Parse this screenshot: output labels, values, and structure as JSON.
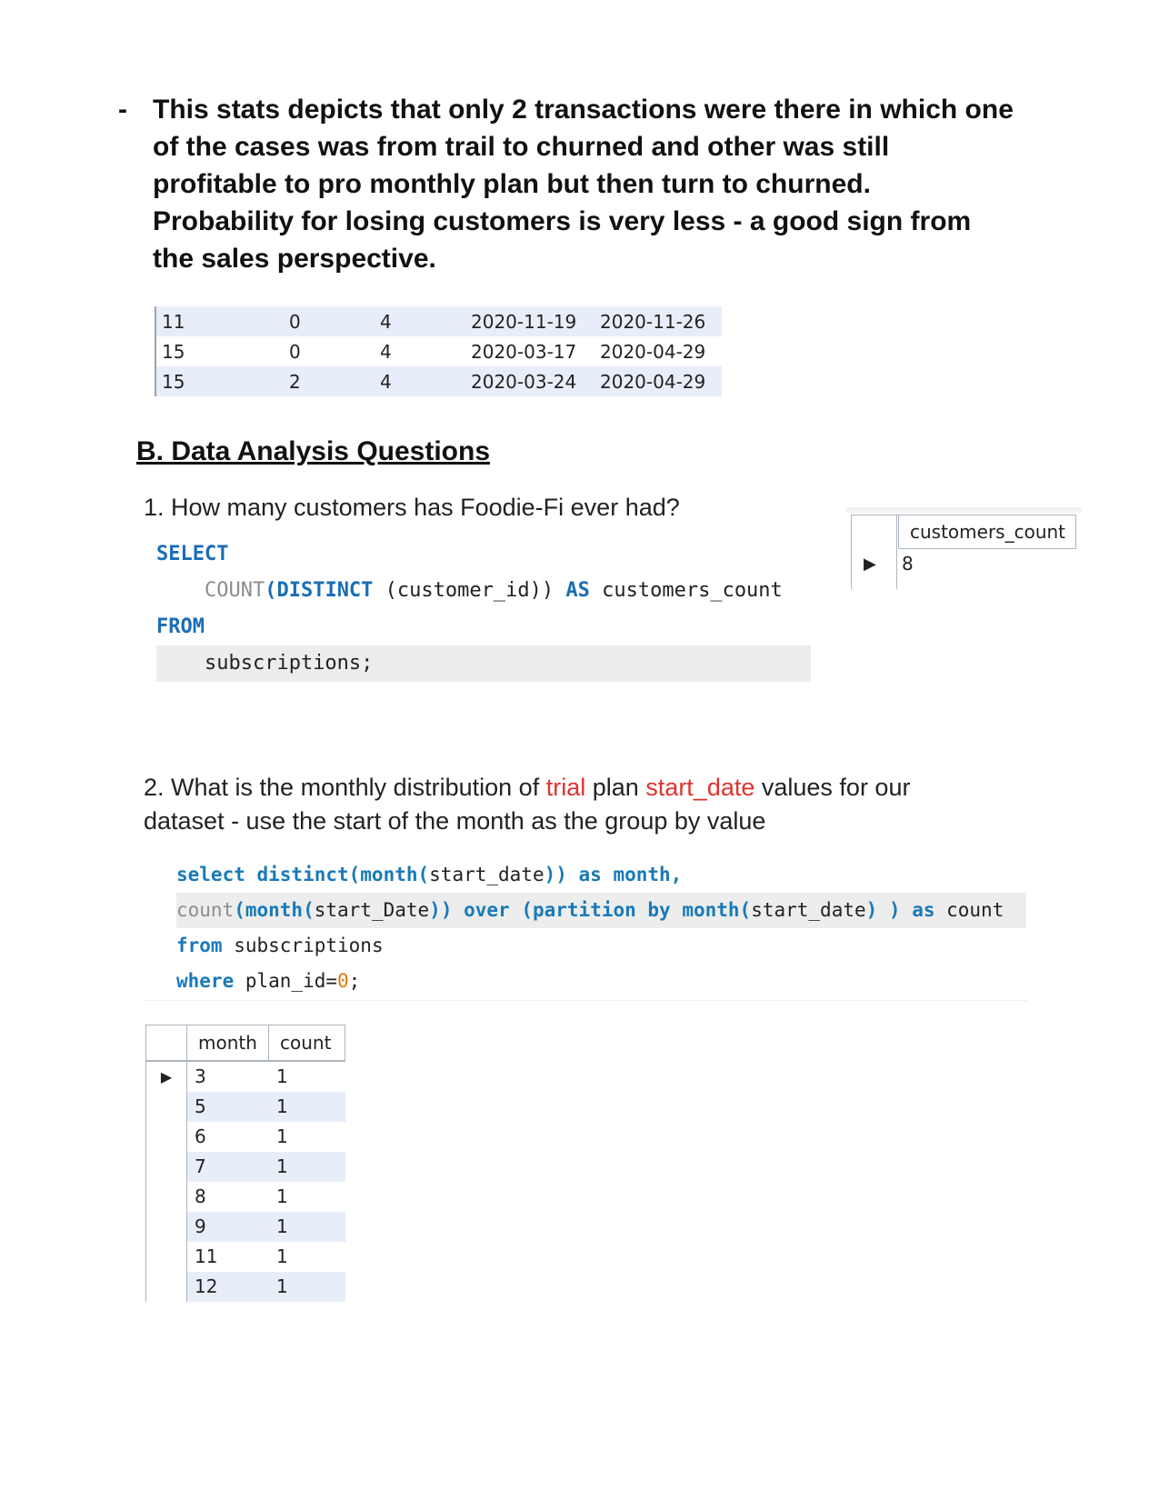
{
  "bullet": {
    "marker": "-",
    "text": "This stats depicts that only 2 transactions were there in which one of the cases was from trail to churned and other was still profitable to pro monthly plan but then turn to churned. Probability for losing customers is very less - a good sign from the sales perspective."
  },
  "result_grid_1": {
    "rows": [
      [
        "11",
        "0",
        "4",
        "2020-11-19",
        "2020-11-26"
      ],
      [
        "15",
        "0",
        "4",
        "2020-03-17",
        "2020-04-29"
      ],
      [
        "15",
        "2",
        "4",
        "2020-03-24",
        "2020-04-29"
      ]
    ]
  },
  "section_heading": "B. Data Analysis Questions",
  "question_1": {
    "text": "1.  How many customers has Foodie-Fi ever had?",
    "code": {
      "l1_kw": "SELECT",
      "l2_fn": "COUNT",
      "l2_kw1": "(DISTINCT",
      "l2_arg": " (customer_id))",
      "l2_kw2": "AS",
      "l2_alias": " customers_count",
      "l3_kw": "FROM",
      "l4_table": "subscriptions;"
    },
    "result": {
      "header": "customers_count",
      "value": "8"
    }
  },
  "question_2": {
    "prefix": "2.  What is the monthly distribution of ",
    "hl1": "trial",
    "mid": " plan ",
    "hl2": "start_date",
    "suffix": " values for our dataset - use the start of the month as the group by value",
    "code": {
      "l1_a": "select distinct(month(",
      "l1_b": "start_date",
      "l1_c": ")) as month,",
      "l2_a": "count",
      "l2_b": "(month(",
      "l2_c": "start_Date",
      "l2_d": ")) over (partition by month(",
      "l2_e": "start_date",
      "l2_f": ") ) as",
      "l2_g": " count",
      "l3_a": "from",
      "l3_b": " subscriptions",
      "l4_a": "where",
      "l4_b": " plan_id=",
      "l4_c": "0",
      "l4_d": ";"
    },
    "result": {
      "headers": [
        "month",
        "count"
      ],
      "rows": [
        [
          "3",
          "1"
        ],
        [
          "5",
          "1"
        ],
        [
          "6",
          "1"
        ],
        [
          "7",
          "1"
        ],
        [
          "8",
          "1"
        ],
        [
          "9",
          "1"
        ],
        [
          "11",
          "1"
        ],
        [
          "12",
          "1"
        ]
      ]
    }
  },
  "colors": {
    "highlight_red": "#e0322c",
    "keyword_blue": "#1a6db5",
    "grid_row_alt": "#e8eef9"
  },
  "icons": {
    "row_selector": "play-triangle-icon"
  }
}
